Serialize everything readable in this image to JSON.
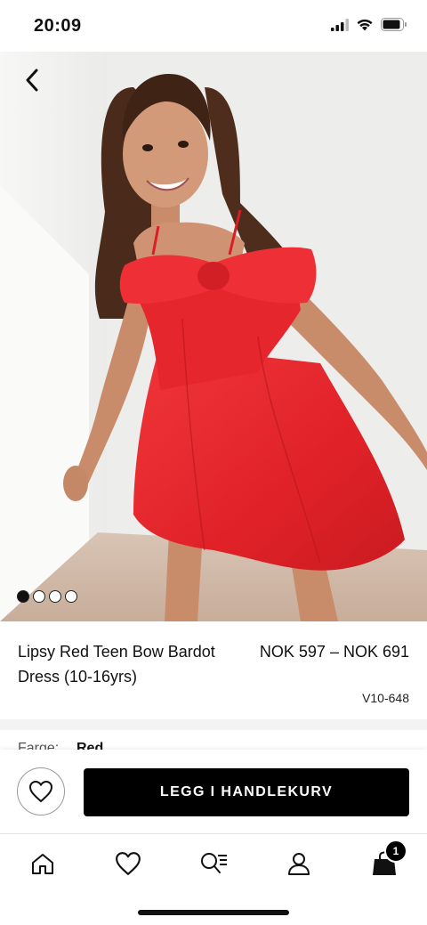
{
  "status_bar": {
    "time": "20:09"
  },
  "product": {
    "title": "Lipsy Red Teen Bow Bardot Dress (10-16yrs)",
    "price": "NOK 597 – NOK 691",
    "code": "V10-648",
    "image_slides": 4,
    "active_slide": 1
  },
  "colour": {
    "label": "Farge:",
    "value": "Red"
  },
  "actions": {
    "add_to_bag_label": "LEGG I HANDLEKURV"
  },
  "tab_bar": {
    "items": [
      "home-icon",
      "heart-icon",
      "search-list-icon",
      "account-icon",
      "bag-icon"
    ],
    "bag_count": "1"
  },
  "colors": {
    "dress": "#e8262c",
    "accent": "#000000"
  }
}
